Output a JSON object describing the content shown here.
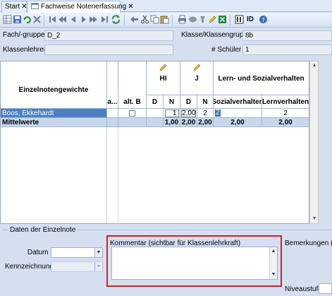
{
  "tabs": [
    {
      "label": "Start",
      "close": "✕"
    },
    {
      "label": "Fachweise Notenerfassung",
      "close": "✕"
    }
  ],
  "toolbar": {
    "id_label": "ID"
  },
  "header": {
    "fach_label": "Fach/-gruppe",
    "fach_value": "D_2",
    "klasse_label": "Klasse/Klassengruppe",
    "klasse_value": "8b",
    "klassenlehrer_label": "Klassenlehrer",
    "klassenlehrer_value": "",
    "schueler_label": "# Schüler",
    "schueler_value": "1"
  },
  "grid": {
    "einzelnotengewichte": "Einzelnotengewichte",
    "col_a": "a...",
    "col_altb": "alt. B",
    "subject1": "HI",
    "subject2": "J",
    "group_lern": "Lern- und Sozialverhalten",
    "col_d": "D",
    "col_n": "N",
    "col_sozial": "Sozialverhalten",
    "col_lern": "Lernverhalten",
    "row1": {
      "name": "Boos, Ekkehardt",
      "hi_n": "1",
      "j_d": "2,00",
      "j_n": "2",
      "sozial": "2",
      "lern": "2"
    },
    "row2": {
      "name": "Mittelwerte",
      "hi_d": "1,00",
      "j_d": "2,00",
      "j_n": "2,00",
      "sozial": "2,00",
      "lern": "2,00"
    }
  },
  "bottom": {
    "legend": "Daten der Einzelnote",
    "datum_label": "Datum",
    "kennzeichnung_label": "Kennzeichnung",
    "kommentar_label": "Kommentar (sichtbar für Klassenlehrkraft)",
    "bemerkungen_label": "Bemerkungen (Fac",
    "niveaustufe_label": "Niveaustufe"
  },
  "colors": {
    "selected_row": "#4a7fc1",
    "mean_row": "#c7d8ee",
    "highlight_border": "#d81e1e"
  }
}
